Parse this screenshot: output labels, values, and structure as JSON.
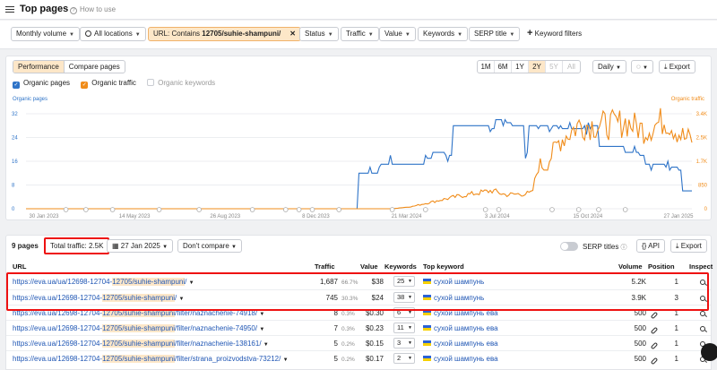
{
  "header": {
    "title": "Top pages",
    "help": "How to use"
  },
  "filters": {
    "volume": "Monthly volume",
    "locations": "All locations",
    "url_prefix": "URL: Contains ",
    "url_value": "12705/suhie-shampuni/",
    "status": "Status",
    "traffic": "Traffic",
    "value": "Value",
    "keywords": "Keywords",
    "serp_title": "SERP title",
    "keyword_filters": "Keyword filters"
  },
  "chart_panel": {
    "tabs": [
      "Performance",
      "Compare pages"
    ],
    "ranges": [
      "1M",
      "6M",
      "1Y",
      "2Y",
      "5Y",
      "All"
    ],
    "active_range": "2Y",
    "interval": "Daily",
    "export": "Export",
    "legend": {
      "pages": "Organic pages",
      "traffic": "Organic traffic",
      "keywords": "Organic keywords"
    },
    "left_axis_title": "Organic pages",
    "right_axis_title": "Organic traffic"
  },
  "chart_data": {
    "type": "line",
    "x_ticks": [
      "30 Jan 2023",
      "14 May 2023",
      "26 Aug 2023",
      "8 Dec 2023",
      "21 Mar 2024",
      "3 Jul 2024",
      "15 Oct 2024",
      "27 Jan 2025"
    ],
    "y_left_ticks": [
      "0",
      "8",
      "16",
      "24",
      "32"
    ],
    "y_right_ticks": [
      "0",
      "850",
      "1.7K",
      "2.5K",
      "3.4K"
    ],
    "y_left_range": [
      0,
      32
    ],
    "y_right_range": [
      0,
      3400
    ],
    "series": [
      {
        "name": "Organic pages",
        "axis": "left",
        "color": "#2f74c8",
        "t": [
          0,
          0.45,
          0.5,
          0.53,
          0.6,
          0.61,
          0.63,
          0.64,
          0.7,
          0.705,
          0.72,
          0.73,
          0.75,
          0.755,
          0.8,
          0.85,
          0.86,
          0.9,
          0.92,
          0.93,
          0.96,
          0.98,
          0.985
        ],
        "v": [
          0,
          0,
          12,
          15,
          17,
          19,
          18,
          28,
          27,
          30,
          29,
          28,
          19,
          28,
          27,
          28,
          21,
          19,
          18,
          15,
          14,
          13,
          6
        ]
      },
      {
        "name": "Organic traffic",
        "axis": "right",
        "color": "#f08c1a",
        "t": [
          0,
          0.55,
          0.58,
          0.62,
          0.65,
          0.7,
          0.72,
          0.76,
          0.77,
          0.78,
          0.8,
          0.83,
          0.88,
          0.9,
          0.93,
          0.96,
          0.99
        ],
        "v": [
          0,
          0,
          80,
          300,
          450,
          650,
          500,
          550,
          1600,
          1500,
          2400,
          3000,
          3000,
          3100,
          2800,
          3200,
          2500
        ]
      }
    ]
  },
  "table": {
    "count": "9 pages",
    "total_traffic": "Total traffic: 2.5K",
    "date": "27 Jan 2025",
    "compare": "Don't compare",
    "serp_titles": "SERP titles",
    "api": "API",
    "export": "Export",
    "headers": {
      "url": "URL",
      "traffic": "Traffic",
      "value": "Value",
      "keywords": "Keywords",
      "top_keyword": "Top keyword",
      "volume": "Volume",
      "position": "Position",
      "inspect": "Inspect"
    },
    "rows": [
      {
        "url_a": "https://eva.ua/ua/12698-12704-",
        "url_b": "12705/suhie-shampuni",
        "url_c": "/",
        "traffic": "1,687",
        "share": "66.7%",
        "value": "$38",
        "keywords": "25",
        "top_keyword": "сухой шампунь",
        "volume": "5.2K",
        "position": "1"
      },
      {
        "url_a": "https://eva.ua/12698-12704-",
        "url_b": "12705/suhie-shampuni",
        "url_c": "/",
        "traffic": "745",
        "share": "30.3%",
        "value": "$24",
        "keywords": "38",
        "top_keyword": "сухой шампунь",
        "volume": "3.9K",
        "position": "3"
      },
      {
        "url_a": "https://eva.ua/12698-12704-",
        "url_b": "12705/suhie-shampuni",
        "url_c": "/filter/naznachenie-74918/",
        "traffic": "8",
        "share": "0.3%",
        "value": "$0.30",
        "keywords": "6",
        "top_keyword": "сухой шампунь ева",
        "volume": "500",
        "position": "1"
      },
      {
        "url_a": "https://eva.ua/12698-12704-",
        "url_b": "12705/suhie-shampuni",
        "url_c": "/filter/naznachenie-74950/",
        "traffic": "7",
        "share": "0.3%",
        "value": "$0.23",
        "keywords": "11",
        "top_keyword": "сухой шампунь ева",
        "volume": "500",
        "position": "1"
      },
      {
        "url_a": "https://eva.ua/12698-12704-",
        "url_b": "12705/suhie-shampuni",
        "url_c": "/filter/naznachenie-138161/",
        "traffic": "5",
        "share": "0.2%",
        "value": "$0.15",
        "keywords": "3",
        "top_keyword": "сухой шампунь ева",
        "volume": "500",
        "position": "1"
      },
      {
        "url_a": "https://eva.ua/12698-12704-",
        "url_b": "12705/suhie-shampuni",
        "url_c": "/filter/strana_proizvodstva-73212/",
        "traffic": "5",
        "share": "0.2%",
        "value": "$0.17",
        "keywords": "2",
        "top_keyword": "сухой шампунь ева",
        "volume": "500",
        "position": "1"
      }
    ]
  }
}
